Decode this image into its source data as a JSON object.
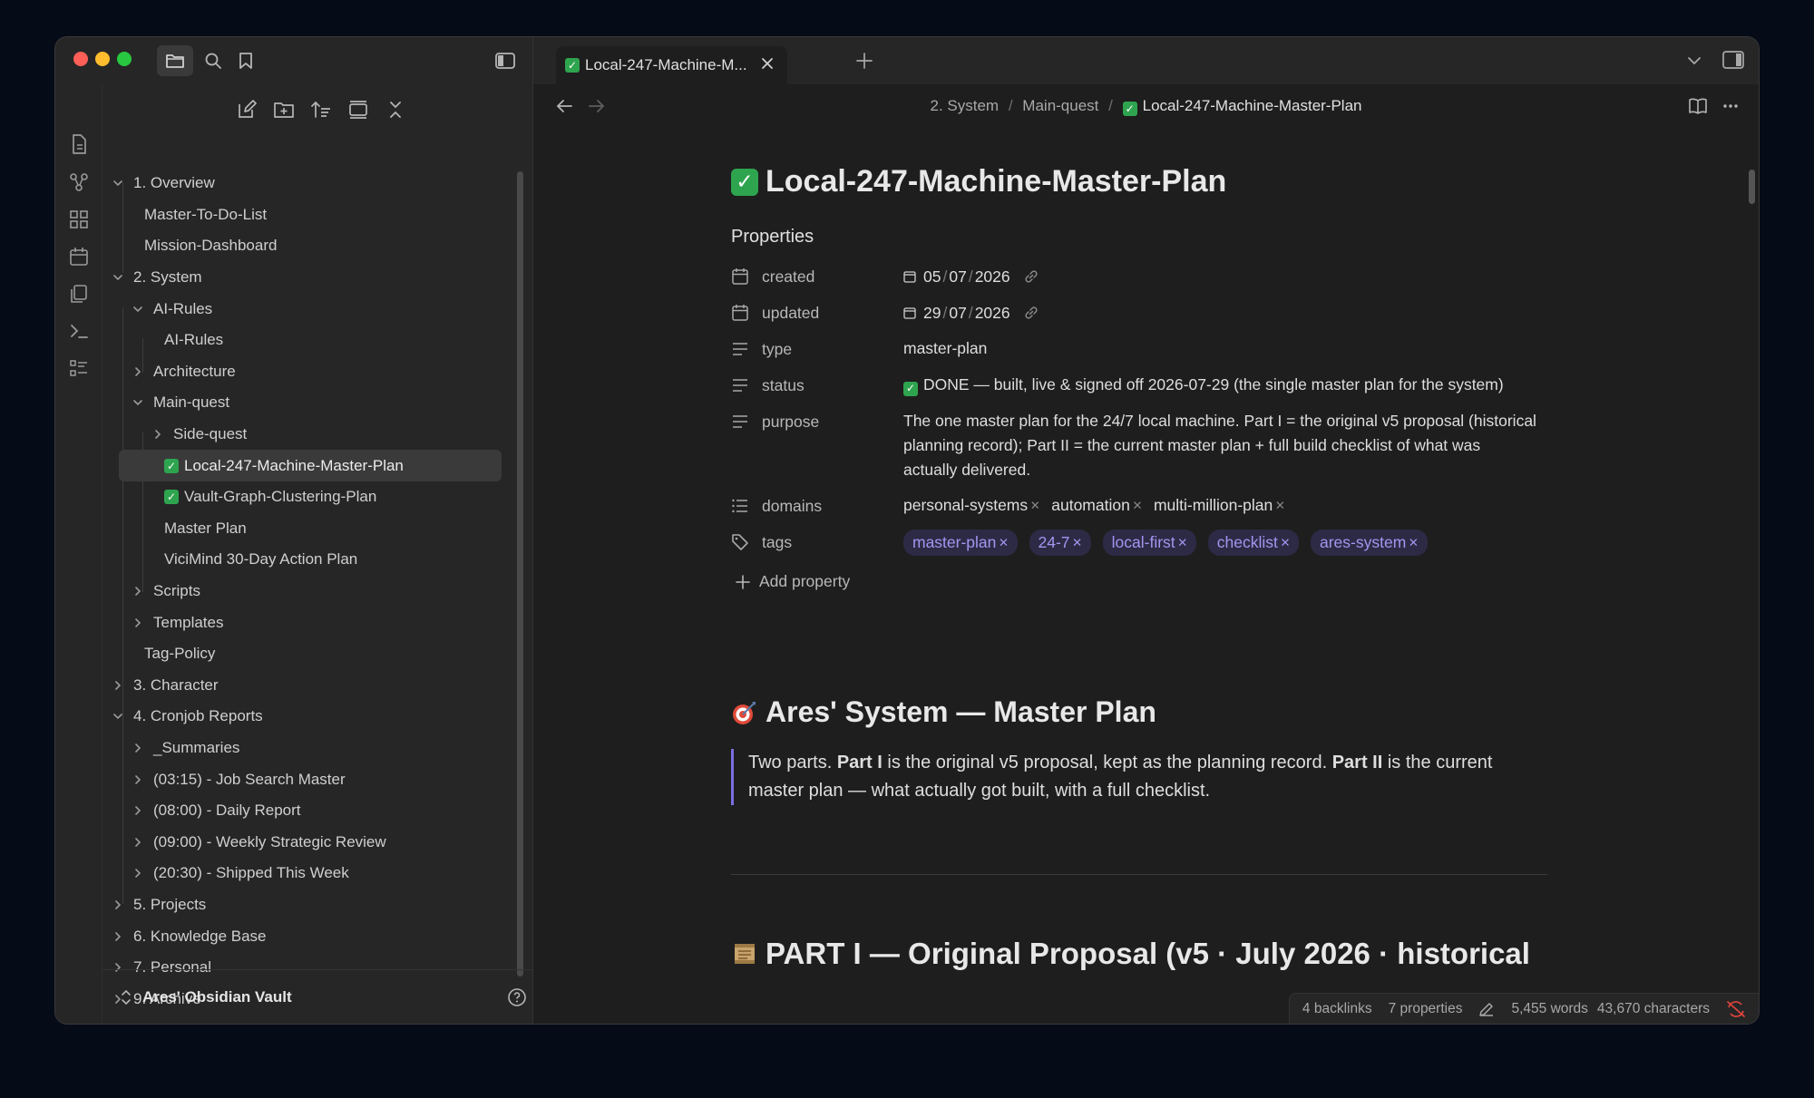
{
  "sidebar": {
    "vault_name": "Ares' Obsidian Vault",
    "tree": [
      {
        "label": "1. Overview",
        "level": 0,
        "type": "folder-open"
      },
      {
        "label": "Master-To-Do-List",
        "level": 1,
        "type": "file"
      },
      {
        "label": "Mission-Dashboard",
        "level": 1,
        "type": "file"
      },
      {
        "label": "2. System",
        "level": 0,
        "type": "folder-open"
      },
      {
        "label": "AI-Rules",
        "level": 1,
        "type": "folder-open"
      },
      {
        "label": "AI-Rules",
        "level": 2,
        "type": "file"
      },
      {
        "label": "Architecture",
        "level": 1,
        "type": "folder-closed"
      },
      {
        "label": "Main-quest",
        "level": 1,
        "type": "folder-open"
      },
      {
        "label": "Side-quest",
        "level": 2,
        "type": "folder-closed"
      },
      {
        "label": "Local-247-Machine-Master-Plan",
        "level": 2,
        "type": "file-check",
        "selected": true
      },
      {
        "label": "Vault-Graph-Clustering-Plan",
        "level": 2,
        "type": "file-check"
      },
      {
        "label": "Master Plan",
        "level": 2,
        "type": "file"
      },
      {
        "label": "ViciMind 30-Day Action Plan",
        "level": 2,
        "type": "file"
      },
      {
        "label": "Scripts",
        "level": 1,
        "type": "folder-closed"
      },
      {
        "label": "Templates",
        "level": 1,
        "type": "folder-closed"
      },
      {
        "label": "Tag-Policy",
        "level": 1,
        "type": "file"
      },
      {
        "label": "3. Character",
        "level": 0,
        "type": "folder-closed"
      },
      {
        "label": "4. Cronjob Reports",
        "level": 0,
        "type": "folder-open"
      },
      {
        "label": "_Summaries",
        "level": 1,
        "type": "folder-closed"
      },
      {
        "label": "(03:15) - Job Search Master",
        "level": 1,
        "type": "folder-closed"
      },
      {
        "label": "(08:00) - Daily Report",
        "level": 1,
        "type": "folder-closed"
      },
      {
        "label": "(09:00) - Weekly Strategic Review",
        "level": 1,
        "type": "folder-closed"
      },
      {
        "label": "(20:30) - Shipped This Week",
        "level": 1,
        "type": "folder-closed"
      },
      {
        "label": "5. Projects",
        "level": 0,
        "type": "folder-closed"
      },
      {
        "label": "6. Knowledge Base",
        "level": 0,
        "type": "folder-closed"
      },
      {
        "label": "7. Personal",
        "level": 0,
        "type": "folder-closed"
      },
      {
        "label": "9. Archive",
        "level": 0,
        "type": "folder-closed"
      }
    ]
  },
  "tab": {
    "label": "Local-247-Machine-M..."
  },
  "breadcrumb": {
    "part1": "2. System",
    "sep": "/",
    "part2": "Main-quest",
    "current": "Local-247-Machine-Master-Plan"
  },
  "note": {
    "title": "Local-247-Machine-Master-Plan",
    "properties_heading": "Properties",
    "properties": {
      "created": {
        "key": "created",
        "d": "05",
        "m": "07",
        "y": "2026"
      },
      "updated": {
        "key": "updated",
        "d": "29",
        "m": "07",
        "y": "2026"
      },
      "type": {
        "key": "type",
        "value": "master-plan"
      },
      "status": {
        "key": "status",
        "value": "DONE — built, live & signed off 2026-07-29 (the single master plan for the system)"
      },
      "purpose": {
        "key": "purpose",
        "value": "The one master plan for the 24/7 local machine. Part I = the original v5 proposal (historical planning record); Part II = the current master plan + full build checklist of what was actually delivered."
      },
      "domains": {
        "key": "domains",
        "values": [
          "personal-systems",
          "automation",
          "multi-million-plan"
        ]
      },
      "tags": {
        "key": "tags",
        "values": [
          "master-plan",
          "24-7",
          "local-first",
          "checklist",
          "ares-system"
        ]
      }
    },
    "add_property": "Add property",
    "h2": "Ares' System — Master Plan",
    "quote": {
      "t1": "Two parts. ",
      "b1": "Part I",
      "t2": " is the original v5 proposal, kept as the planning record. ",
      "b2": "Part II",
      "t3": " is the current master plan — what actually got built, with a full checklist."
    },
    "h1_part1": "PART I — Original Proposal (v5 · July 2026 · historical"
  },
  "statusbar": {
    "backlinks": "4 backlinks",
    "properties": "7 properties",
    "words": "5,455 words",
    "characters": "43,670 characters"
  },
  "colors": {
    "accent": "#a495f0",
    "check": "#2fa44f",
    "tag_bg": "#2d2a45"
  }
}
